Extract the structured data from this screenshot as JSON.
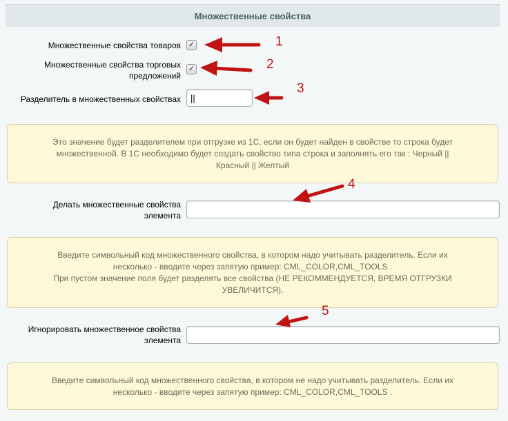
{
  "header": {
    "title": "Множественные свойства"
  },
  "fields": {
    "multi_props_goods": {
      "label": "Множественные свойства товаров",
      "checked": true
    },
    "multi_props_offers": {
      "label_line1": "Множественные свойства торговых",
      "label_line2": "предложений",
      "checked": true
    },
    "separator": {
      "label": "Разделитель в множественных свойствах",
      "value": "||"
    },
    "make_multi": {
      "label_line1": "Делать множественные свойства",
      "label_line2": "элемента",
      "value": ""
    },
    "ignore_multi": {
      "label_line1": "Игнорировать множественное свойства",
      "label_line2": "элемента",
      "value": ""
    }
  },
  "hints": {
    "separator_hint": {
      "line1": "Это значение будет разделителем при отгрузке из 1С, если он будет найден в свойстве то строка будет",
      "line2": "множественной. В 1С необходимо будет создать свойство типа строка и заполнять его так : Черный ||",
      "line3": "Красный || Желтый"
    },
    "make_multi_hint": {
      "line1": "Введите символьный код множественного свойства, в котором надо учитывать разделитель. Если их",
      "line2": "несколько - вводите через запятую пример: CML_COLOR,CML_TOOLS .",
      "line3": "При пустом значение поля будет разделять все свойства (НЕ РЕКОММЕНДУЕТСЯ, ВРЕМЯ ОТГРУЗКИ",
      "line4": "УВЕЛИЧИТСЯ)."
    },
    "ignore_multi_hint": {
      "line1": "Введите символьный код множественного свойства, в котором не надо учитывать разделитель. Если их",
      "line2": "несколько - вводите через запятую пример: CML_COLOR,CML_TOOLS ."
    }
  },
  "annotations": [
    "1",
    "2",
    "3",
    "4",
    "5"
  ],
  "colors": {
    "annotation": "#c01414",
    "header_bg": "#e0e8ea",
    "hint_bg": "#fdf9d8"
  }
}
